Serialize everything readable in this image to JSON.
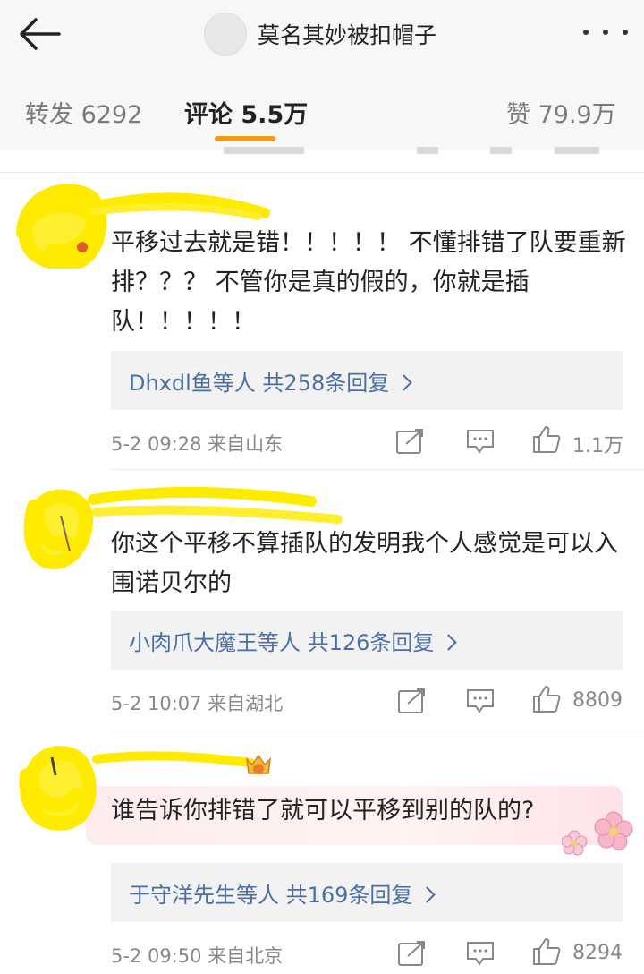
{
  "header": {
    "title": "莫名其妙被扣帽子"
  },
  "tabs": [
    {
      "label": "转发 6292"
    },
    {
      "label": "评论 5.5万"
    },
    {
      "label": "赞 79.9万"
    }
  ],
  "colors": {
    "accent": "#f39c12",
    "link": "#4a6fa5",
    "highlight": "#ffff00"
  },
  "comments": [
    {
      "text": "平移过去就是错！！！！！ 不懂排错了队要重新排？？？ 不管你是真的假的，你就是插队！！！！！",
      "replies": "Dhxdl鱼等人  共258条回复",
      "meta": "5-2 09:28  来自山东",
      "likes": "1.1万"
    },
    {
      "text": "你这个平移不算插队的发明我个人感觉是可以入围诺贝尔的",
      "replies": "小肉爪大魔王等人  共126条回复",
      "meta": "5-2 10:07  来自湖北",
      "likes": "8809"
    },
    {
      "text": "谁告诉你排错了就可以平移到别的队的?",
      "replies": "于守洋先生等人  共169条回复",
      "meta": "5-2 09:50  来自北京",
      "likes": "8294"
    }
  ]
}
